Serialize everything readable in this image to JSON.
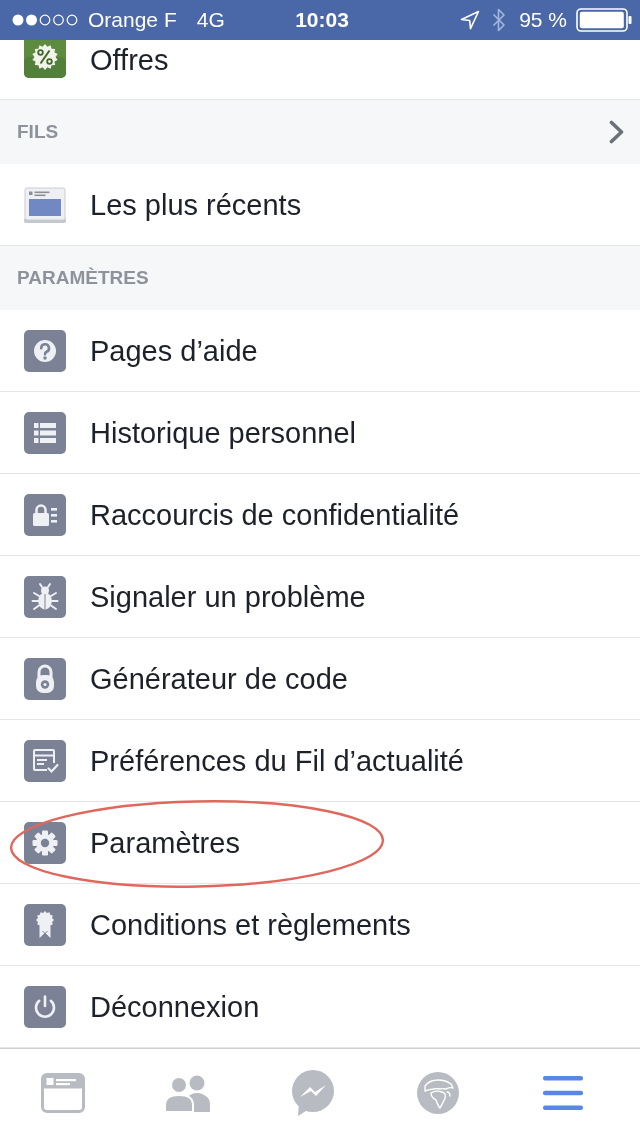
{
  "status_bar": {
    "carrier": "Orange F",
    "network": "4G",
    "time": "10:03",
    "battery": "95 %"
  },
  "partial_item": {
    "label": "Offres"
  },
  "sections": [
    {
      "header": "FILS",
      "expandable": true,
      "items": [
        {
          "label": "Les plus récents",
          "circled": false
        }
      ]
    },
    {
      "header": "PARAMÈTRES",
      "expandable": false,
      "items": [
        {
          "label": "Pages d’aide",
          "circled": false
        },
        {
          "label": "Historique personnel",
          "circled": false
        },
        {
          "label": "Raccourcis de confidentialité",
          "circled": false
        },
        {
          "label": "Signaler un problème",
          "circled": false
        },
        {
          "label": "Générateur de code",
          "circled": false
        },
        {
          "label": "Préférences du Fil d’actualité",
          "circled": false
        },
        {
          "label": "Paramètres",
          "circled": true
        },
        {
          "label": "Conditions et règlements",
          "circled": false
        },
        {
          "label": "Déconnexion",
          "circled": false
        }
      ]
    }
  ],
  "tab_bar": [
    {
      "selected": false
    },
    {
      "selected": false
    },
    {
      "selected": false
    },
    {
      "selected": false
    },
    {
      "selected": true
    }
  ]
}
